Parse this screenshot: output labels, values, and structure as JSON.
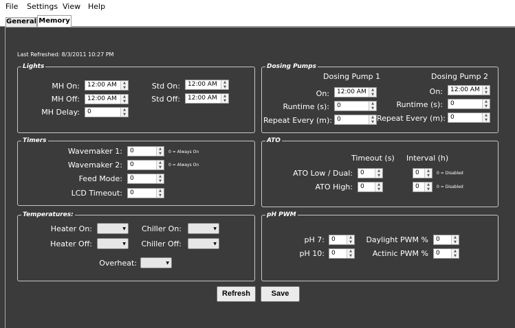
{
  "menu": {
    "file": "File",
    "settings": "Settings",
    "view": "View",
    "help": "Help"
  },
  "tabs": {
    "general": "General",
    "memory": "Memory"
  },
  "last_refreshed": "Last Refreshed: 8/3/2011 10:27 PM",
  "lights": {
    "title": "Lights",
    "mh_on_label": "MH On:",
    "mh_on": "12:00 AM",
    "mh_off_label": "MH Off:",
    "mh_off": "12:00 AM",
    "mh_delay_label": "MH Delay:",
    "mh_delay": "0",
    "std_on_label": "Std On:",
    "std_on": "12:00 AM",
    "std_off_label": "Std Off:",
    "std_off": "12:00 AM"
  },
  "dosing": {
    "title": "Dosing Pumps",
    "pump1": {
      "title": "Dosing Pump 1",
      "on_label": "On:",
      "on": "12:00 AM",
      "runtime_label": "Runtime (s):",
      "runtime": "0",
      "repeat_label": "Repeat Every (m):",
      "repeat": "0"
    },
    "pump2": {
      "title": "Dosing Pump 2",
      "on_label": "On:",
      "on": "12:00 AM",
      "runtime_label": "Runtime (s):",
      "runtime": "0",
      "repeat_label": "Repeat Every (m):",
      "repeat": "0"
    }
  },
  "timers": {
    "title": "Timers",
    "wm1_label": "Wavemaker 1:",
    "wm1": "0",
    "wm1_note": "0 = Always On",
    "wm2_label": "Wavemaker 2:",
    "wm2": "0",
    "wm2_note": "0 = Always On",
    "feed_label": "Feed Mode:",
    "feed": "0",
    "lcd_label": "LCD Timeout:",
    "lcd": "0"
  },
  "ato": {
    "title": "ATO",
    "timeout_header": "Timeout (s)",
    "interval_header": "Interval (h)",
    "low_label": "ATO Low / Dual:",
    "low_timeout": "0",
    "low_interval": "0",
    "low_note": "0 = Disabled",
    "high_label": "ATO High:",
    "high_timeout": "0",
    "high_interval": "0",
    "high_note": "0 = Disabled"
  },
  "temps": {
    "title": "Temperatures:",
    "heater_on_label": "Heater On:",
    "heater_off_label": "Heater Off:",
    "chiller_on_label": "Chiller On:",
    "chiller_off_label": "Chiller Off:",
    "overheat_label": "Overheat:"
  },
  "ph": {
    "title": "pH  PWM",
    "ph7_label": "pH 7:",
    "ph7": "0",
    "ph10_label": "pH 10:",
    "ph10": "0",
    "daylight_label": "Daylight PWM %",
    "daylight": "0",
    "actinic_label": "Actinic PWM %",
    "actinic": "0"
  },
  "buttons": {
    "refresh": "Refresh",
    "save": "Save"
  }
}
